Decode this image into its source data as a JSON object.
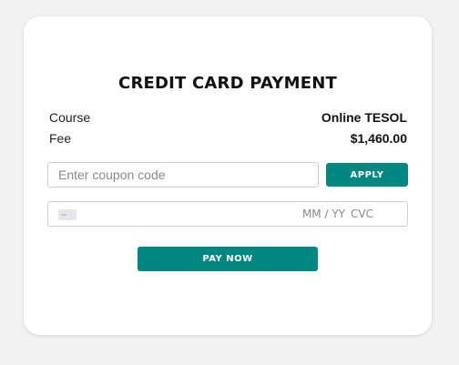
{
  "payment": {
    "title": "CREDIT CARD PAYMENT",
    "course_label": "Course",
    "course_value": "Online TESOL",
    "fee_label": "Fee",
    "fee_value": "$1,460.00"
  },
  "coupon": {
    "placeholder": "Enter coupon code",
    "value": "",
    "apply_label": "APPLY"
  },
  "card_input": {
    "icon": "credit-card-icon",
    "number_value": "",
    "expiry_placeholder": "MM / YY",
    "cvc_placeholder": "CVC"
  },
  "pay_label": "PAY NOW",
  "colors": {
    "accent": "#00877f",
    "background": "#f2f2f2",
    "card": "#ffffff"
  }
}
